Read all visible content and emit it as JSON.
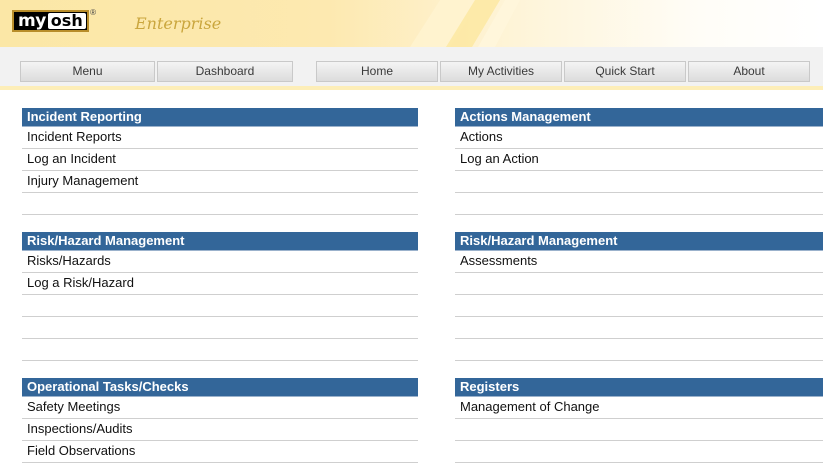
{
  "brand": {
    "logo_my": "my",
    "logo_osh": "osh",
    "logo_reg": "®",
    "edition": "Enterprise"
  },
  "nav": {
    "left_tabs": [
      {
        "label": "Menu"
      },
      {
        "label": "Dashboard"
      }
    ],
    "right_tabs": [
      {
        "label": "Home"
      },
      {
        "label": "My Activities"
      },
      {
        "label": "Quick Start"
      },
      {
        "label": "About"
      }
    ]
  },
  "sections": {
    "incident": {
      "title": "Incident Reporting",
      "items": [
        "Incident Reports",
        "Log an Incident",
        "Injury Management"
      ]
    },
    "actions": {
      "title": "Actions Management",
      "items": [
        "Actions",
        "Log an Action"
      ]
    },
    "risk_left": {
      "title": "Risk/Hazard Management",
      "items": [
        "Risks/Hazards",
        "Log a Risk/Hazard"
      ]
    },
    "risk_right": {
      "title": "Risk/Hazard Management",
      "items": [
        "Assessments"
      ]
    },
    "operational": {
      "title": "Operational Tasks/Checks",
      "items": [
        "Safety Meetings",
        "Inspections/Audits",
        "Field Observations"
      ]
    },
    "registers": {
      "title": "Registers",
      "items": [
        "Management of Change"
      ]
    }
  },
  "colors": {
    "section_header": "#336699",
    "header_gold": "#fbe7a6",
    "edition_text": "#caa63e"
  }
}
